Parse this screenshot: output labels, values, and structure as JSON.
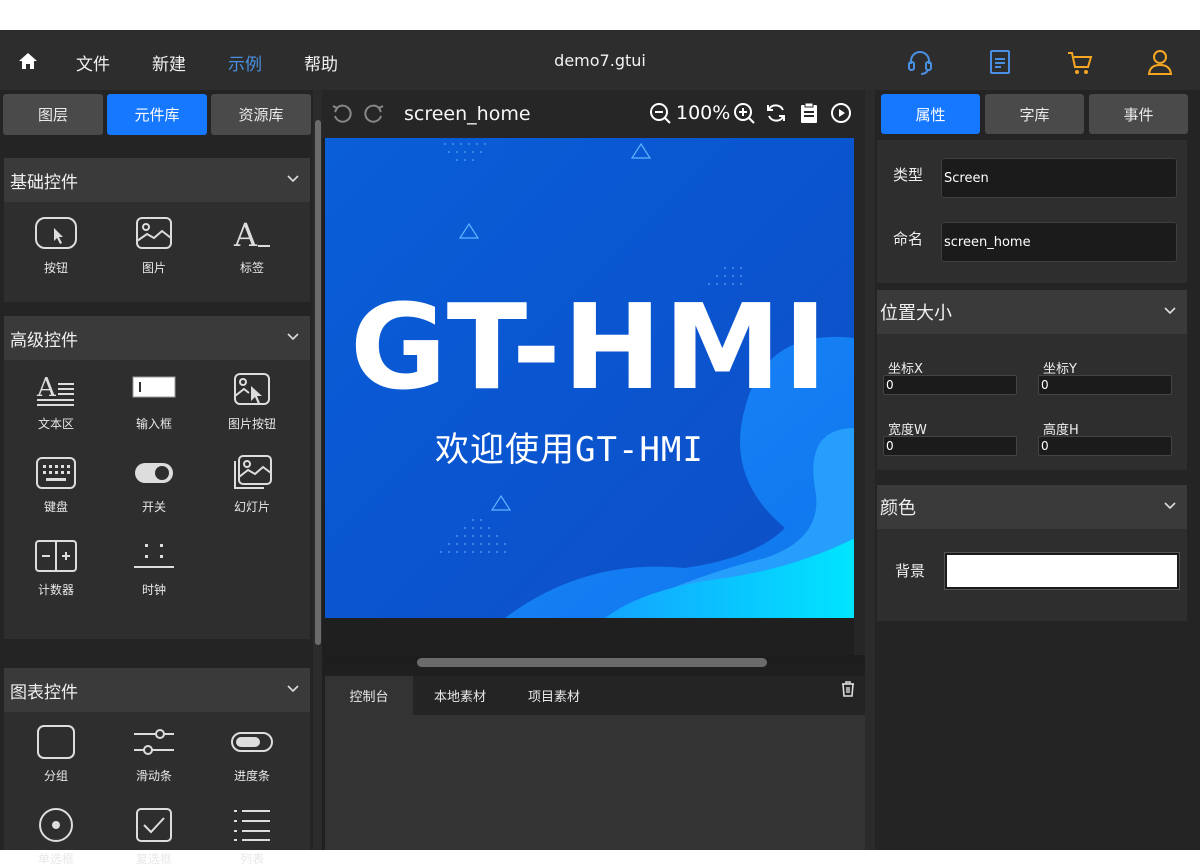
{
  "menubar": {
    "items": [
      "文件",
      "新建",
      "示例",
      "帮助"
    ],
    "active_index": 2,
    "title": "demo7.gtui",
    "accent": "#4a90e2",
    "icons": [
      "headset-icon",
      "document-icon",
      "cart-icon",
      "user-icon"
    ],
    "icon_colors": [
      "#4a90e2",
      "#4a90e2",
      "#f5a623",
      "#f5a623"
    ]
  },
  "left": {
    "tabs": [
      "图层",
      "元件库",
      "资源库"
    ],
    "active_tab": 1,
    "sections": [
      {
        "title": "基础控件",
        "items": [
          {
            "label": "按钮",
            "icon": "button-icon"
          },
          {
            "label": "图片",
            "icon": "image-icon"
          },
          {
            "label": "标签",
            "icon": "label-icon",
            "glyph": "A_"
          }
        ]
      },
      {
        "title": "高级控件",
        "items": [
          {
            "label": "文本区",
            "icon": "textarea-icon"
          },
          {
            "label": "输入框",
            "icon": "input-box-icon",
            "glyph": "I"
          },
          {
            "label": "图片按钮",
            "icon": "image-button-icon"
          },
          {
            "label": "键盘",
            "icon": "keyboard-icon"
          },
          {
            "label": "开关",
            "icon": "switch-icon"
          },
          {
            "label": "幻灯片",
            "icon": "slideshow-icon"
          },
          {
            "label": "计数器",
            "icon": "counter-icon"
          },
          {
            "label": "时钟",
            "icon": "clock-icon"
          }
        ]
      },
      {
        "title": "图表控件",
        "items": [
          {
            "label": "分组",
            "icon": "group-icon"
          },
          {
            "label": "滑动条",
            "icon": "slider-icon"
          },
          {
            "label": "进度条",
            "icon": "progress-bar-icon"
          },
          {
            "label": "单选框",
            "icon": "radio-icon"
          },
          {
            "label": "复选框",
            "icon": "checkbox-icon"
          },
          {
            "label": "列表",
            "icon": "list-icon"
          }
        ]
      }
    ]
  },
  "canvas": {
    "screen_name": "screen_home",
    "zoom": "100%",
    "headline": "GT-HMI",
    "subtitle": "欢迎使用GT-HMI",
    "bg_color": "#0a5ed8"
  },
  "console": {
    "tabs": [
      "控制台",
      "本地素材",
      "项目素材"
    ],
    "active_tab": 0
  },
  "right": {
    "tabs": [
      "属性",
      "字库",
      "事件"
    ],
    "active_tab": 0,
    "type_label": "类型",
    "type_value": "Screen",
    "name_label": "命名",
    "name_value": "screen_home",
    "position_title": "位置大小",
    "x_label": "坐标X",
    "x_value": "0",
    "y_label": "坐标Y",
    "y_value": "0",
    "w_label": "宽度W",
    "w_value": "0",
    "h_label": "高度H",
    "h_value": "0",
    "color_title": "颜色",
    "bg_label": "背景",
    "bg_color": "#ffffff"
  }
}
